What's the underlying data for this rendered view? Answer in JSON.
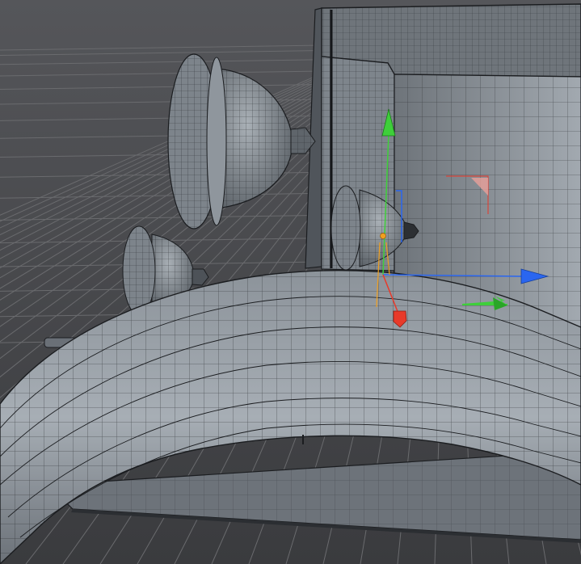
{
  "viewport": {
    "scene": "3d-wireframe-viewport",
    "background_color": "#4a4b4e",
    "floor_grid_color": "#6a6b6e",
    "mesh_fill_color": "#8e959c",
    "mesh_edge_color": "#1b1d20"
  },
  "gizmo": {
    "x_axis_color": "#e83a2a",
    "y_axis_color": "#3ecf3a",
    "z_axis_color": "#2a66f0",
    "pivot_color": "#f0a020",
    "icons": [
      "move-y-arrow-icon",
      "move-z-arrow-icon",
      "move-x-handle-icon",
      "plane-handle-icon"
    ]
  }
}
